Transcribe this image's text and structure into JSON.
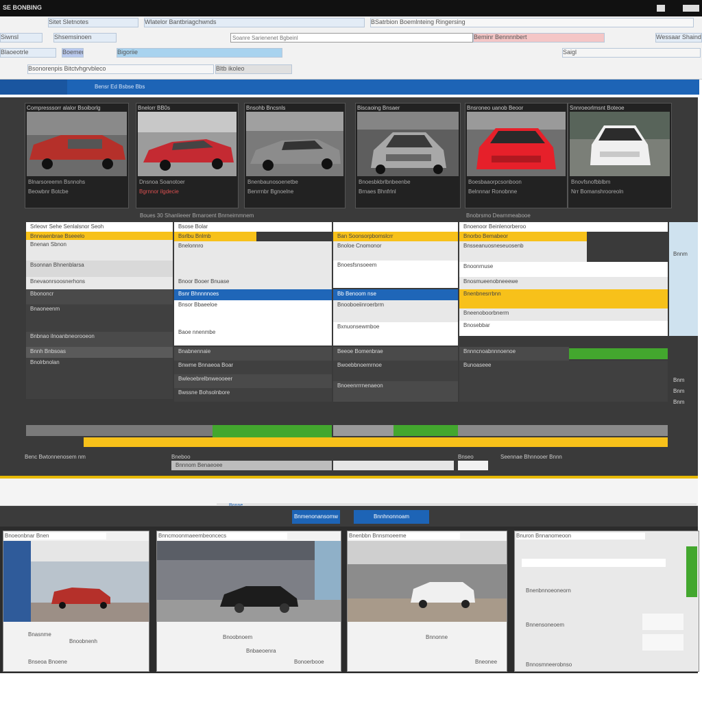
{
  "window": {
    "title": "SE BONBING"
  },
  "toolbar": {
    "row1": [
      "Sitet Sletnotes",
      "Wlatelor Bantbriagchwnds",
      "BSatrbion Boemlnteing Ringersing"
    ],
    "row2": [
      "Siwnsl",
      "Shsemsinoen",
      "Beminr Bennnnbert",
      "Wessaar Shaindoo",
      "Blaoeotrle",
      "Boemerbwe",
      "Bigoriie"
    ],
    "row3": [
      "Bsonorenpis Bitctvhgrvbleco",
      "Saigl",
      "Bltb ikoleo"
    ],
    "search_placeholder": "Soanre Sarienenet Bgbeinl"
  },
  "bluebar": {
    "label": "Bensr Ed Bsbse Bbs"
  },
  "cars": [
    {
      "caption": "Compresssorr alalor Bsoiborlg",
      "meta": [
        "Blnarsoreemn Bsnnohs",
        "Beowbnr Botcbe"
      ],
      "body": "#b5302a"
    },
    {
      "caption": "Bnelorr BB0s",
      "meta": [
        "Dnsnoa Soanotoer",
        "Bgrnnor ilgdecie"
      ],
      "body": "#c42a32"
    },
    {
      "caption": "Bnsohb Bncsnls",
      "meta": [
        "Bnenbaunosoenetbe",
        "Benrrnbr Bgnoelne"
      ],
      "body": "#8c8c8c"
    },
    {
      "caption": "Biscaoing Bnsaer",
      "meta": [
        "Bnoesbkbrlbnbeenbe",
        "Brnaes Bhnfrlnl"
      ],
      "body": "#a8a8a8"
    },
    {
      "caption": "Bnsroneo uanob Beoor",
      "meta": [
        "Boesbaaorpcsonboon",
        "Belnnnar Ronobnne"
      ],
      "body": "#e6202a"
    },
    {
      "caption": "Snnroeorlmsnt Boteoe",
      "meta": [
        "Bnovfsnofbblbm",
        "Nrr Bomanshrooreoln"
      ],
      "body": "#f0f0f0"
    }
  ],
  "cars_footer": [
    "Boues 30 Shanlieeer Brnaroent Bnrneirnmnem",
    "Bnobrsmo Dearnmeabooe"
  ],
  "table": {
    "col1_header": "Srleovr Sehe Senlalsnor Seoh",
    "col2_header": "Bsose Bolar",
    "col4_header": "Bnoenoor Beinlenorberoo",
    "col1_rows": [
      "Bnneaenbrae Bseeelo",
      "Bnenan Sbnon",
      "Bsonnan Bhnenblarsa",
      "Bnevaonrsoosnerhons",
      "Bbononcr",
      "Bnaoneenm",
      "Bnbnao ilnoanbneorooeon",
      "Bnnh Bnbsoas",
      "Bnolrbnolan"
    ],
    "col2_rows": [
      "Bsrlbu Bnlmb",
      "Bnelonnro",
      "Bnoor Booer Bnuase",
      "Bnsor Bbaeeloe",
      "Baoe nnenmbe",
      "Bnabnennaie",
      "Bnwme Bnnaeoa Boar",
      "Bwleoebrelbnweooeer",
      "Bwssne Bohsolnbore"
    ],
    "col3_rows": [
      "Ban Soonsorpbomslcrr",
      "Bnoloe Cnomonor",
      "Bnoesfsnsoeem",
      "Bnooboeiinroerbrm",
      "Bxnuonsewmboe",
      "Beeoe Bomenbrae",
      "Bwoebbnoemrnoe",
      "Bnoeenrrrnenaeon"
    ],
    "col4_rows": [
      "Bnorbo Bemabeor",
      "Bnsseanuosneseuosenb",
      "Bnoonrnuse",
      "Bnosmueenobneeewe",
      "Bnenbnesrrbnn",
      "Bneenoboorbnerm",
      "Bnosebbar",
      "Bnnncnoabnnnoenoe",
      "Bunoaseee"
    ],
    "blue_cells": [
      "Bsnr Bhnnnnoes",
      "Bb Benoom nse"
    ],
    "right_col": [
      "Bnnm",
      "Bnm",
      "Bnm",
      "Bnm"
    ]
  },
  "panel_footer": [
    "Benc Bwtonnenosem nm",
    "Bneboo",
    "Bnnnom Benaeoee",
    "Bnseo",
    "Seennae Bhnnooer Bnnn"
  ],
  "lower": {
    "label": "Bnnne"
  },
  "tabs": [
    "Bnmenonansomw",
    "Bnnhnonnoam"
  ],
  "gallery": [
    {
      "caption": "Bnoeonbnar Bnen",
      "lines": [
        "Bnasnme",
        "Bnoobnenh",
        "Bnseoa Bnoene"
      ]
    },
    {
      "caption": "Bnncmoonmaeembeoncecs",
      "lines": [
        "Bnoobnoem",
        "Bnbaeoenra",
        "Bonoerbooe"
      ]
    },
    {
      "caption": "Bnenbbn Bnnsmoeeme",
      "lines": [
        "Bnnonne",
        "Bneonee"
      ]
    },
    {
      "caption": "Bnuron Bnnanomeoon",
      "lines": [
        "Bnenbnnoeoneorn",
        "Bnnensoneoem",
        "Bnnosmneerobnso"
      ]
    }
  ],
  "colors": {
    "accent": "#1d64b6",
    "highlight": "#f7c11a",
    "success": "#43a72e"
  }
}
